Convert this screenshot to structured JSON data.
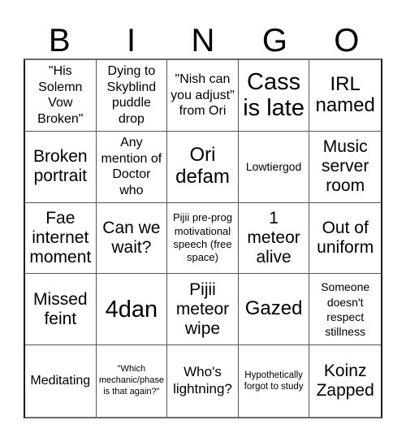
{
  "header": {
    "letters": [
      "B",
      "I",
      "N",
      "G",
      "O"
    ]
  },
  "board": {
    "free_space_index": 12,
    "cells": [
      "\"His Solemn Vow Broken\"",
      "Dying to Skyblind puddle drop",
      "\"Nish can you adjust\" from Ori",
      "Cass is late",
      "IRL named",
      "Broken portrait",
      "Any mention of Doctor who",
      "Ori defam",
      "Lowtiergod",
      "Music server room",
      "Fae internet moment",
      "Can we wait?",
      "Pijii pre-prog motivational speech (free space)",
      "1 meteor alive",
      "Out of uniform",
      "Missed feint",
      "4dan",
      "Pijii meteor wipe",
      "Gazed",
      "Someone doesn't respect stillness",
      "Meditating",
      "\"Which mechanic/phase is that again?\"",
      "Who's lightning?",
      "Hypothetically forgot to study",
      "Koinz Zapped"
    ]
  }
}
